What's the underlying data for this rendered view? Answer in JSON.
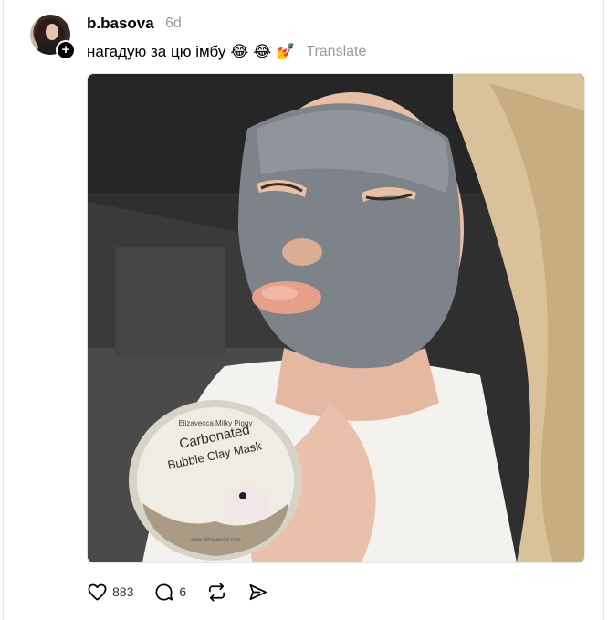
{
  "post": {
    "username": "b.basova",
    "timestamp": "6d",
    "caption": "нагадую за цю імбу",
    "emojis": [
      "😂",
      "😂",
      "💅"
    ],
    "translate_label": "Translate",
    "follow_symbol": "+",
    "image": {
      "jar_label": {
        "brand": "Elizavecca Milky Piggy",
        "line1": "Carbonated",
        "line2": "Bubble Clay Mask",
        "url": "www.elizavecca.com"
      }
    },
    "actions": {
      "like_count": "883",
      "reply_count": "6"
    }
  },
  "colors": {
    "text": "#000000",
    "muted": "#999999",
    "divider": "#e6e6e6"
  }
}
